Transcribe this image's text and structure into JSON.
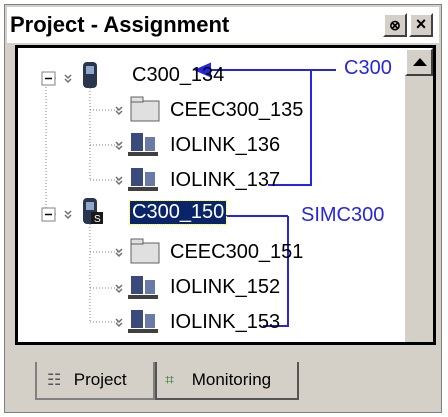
{
  "panel": {
    "title": "Project - Assignment",
    "buttons": [
      {
        "name": "pin",
        "glyph": "⊗"
      },
      {
        "name": "close",
        "glyph": "×"
      }
    ]
  },
  "tree": {
    "nodes": [
      {
        "label": "C300_134",
        "type": "controller",
        "expanded": true,
        "selected": false
      },
      {
        "label": "CEEC300_135",
        "type": "folder"
      },
      {
        "label": "IOLINK_136",
        "type": "iolink"
      },
      {
        "label": "IOLINK_137",
        "type": "iolink"
      },
      {
        "label": "C300_150",
        "type": "simcontroller",
        "expanded": true,
        "selected": true
      },
      {
        "label": "CEEC300_151",
        "type": "folder"
      },
      {
        "label": "IOLINK_152",
        "type": "iolink"
      },
      {
        "label": "IOLINK_153",
        "type": "iolink"
      }
    ]
  },
  "annotations": {
    "c300": "C300",
    "simc300": "SIMC300",
    "color": "#2626e0"
  },
  "tabs": [
    {
      "label": "Project",
      "icon": "project-icon",
      "active": true
    },
    {
      "label": "Monitoring",
      "icon": "monitoring-icon",
      "active": false
    }
  ]
}
